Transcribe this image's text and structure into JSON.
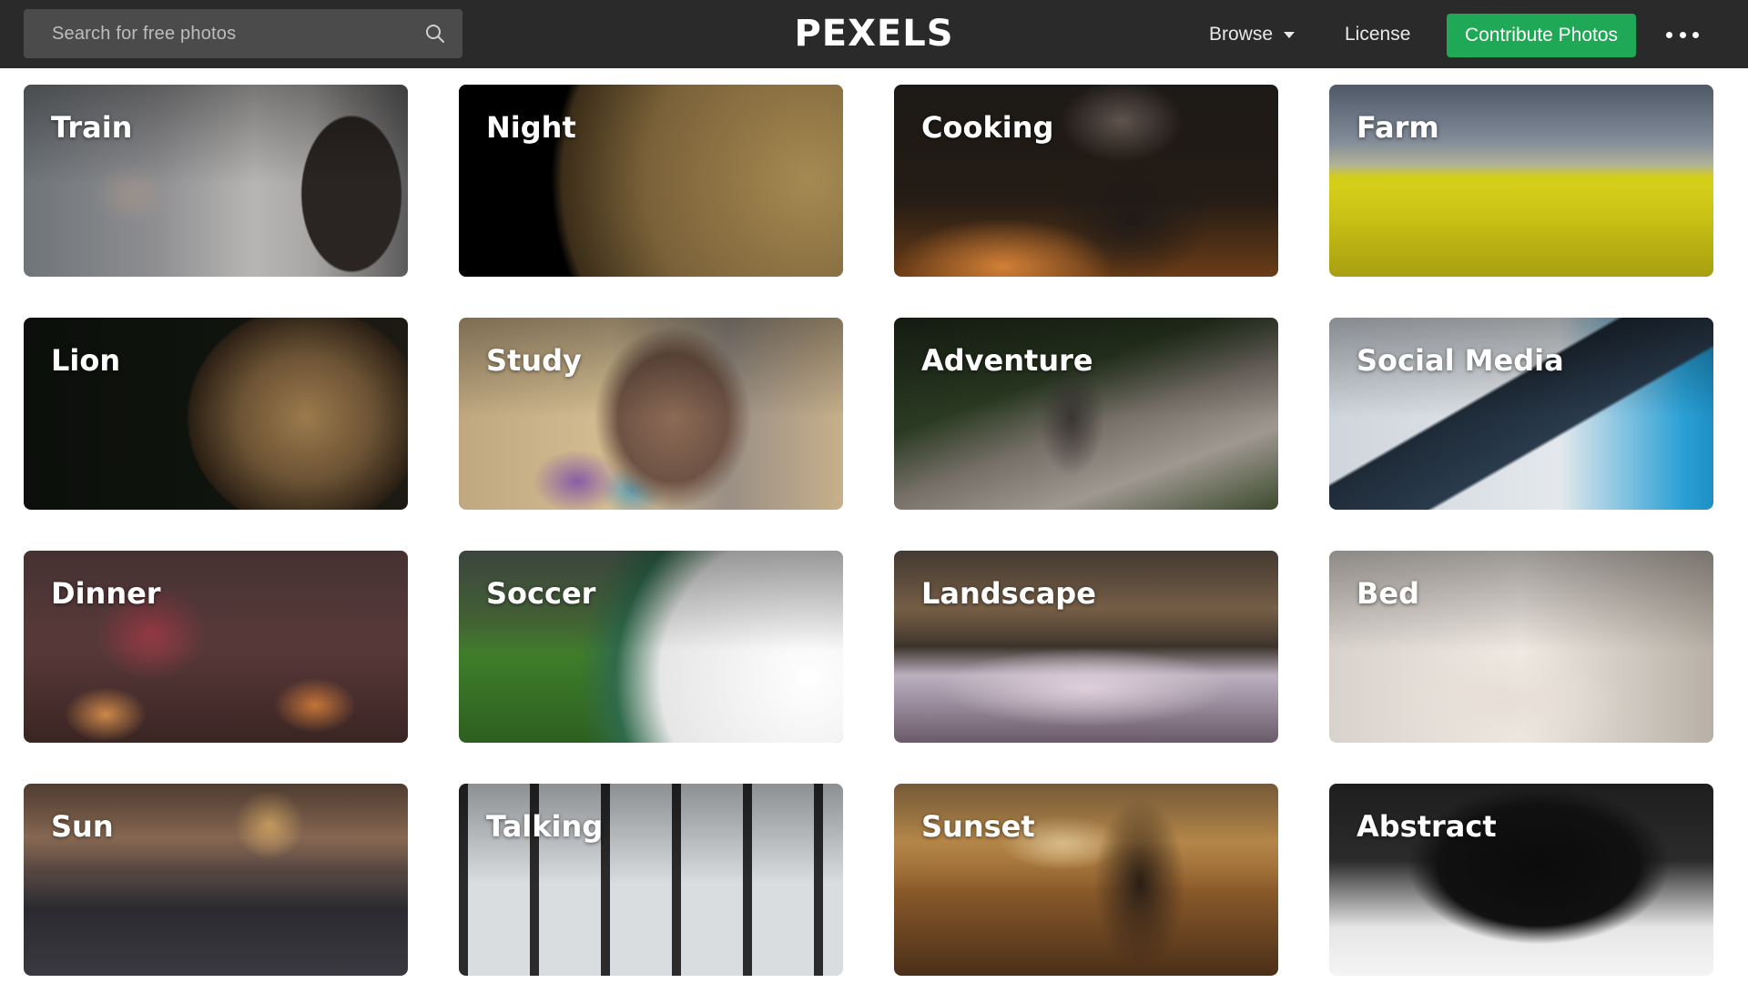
{
  "header": {
    "search_placeholder": "Search for free photos",
    "logo_text": "PEXELS",
    "nav": {
      "browse_label": "Browse",
      "license_label": "License",
      "contribute_label": "Contribute Photos",
      "more_icon": "more-dots-icon"
    },
    "colors": {
      "bar_background": "#2a2a2a",
      "search_background": "#4b4b4b",
      "contribute_button": "#1fa855"
    }
  },
  "categories": [
    {
      "label": "Train"
    },
    {
      "label": "Night"
    },
    {
      "label": "Cooking"
    },
    {
      "label": "Farm"
    },
    {
      "label": "Lion"
    },
    {
      "label": "Study"
    },
    {
      "label": "Adventure"
    },
    {
      "label": "Social Media"
    },
    {
      "label": "Dinner"
    },
    {
      "label": "Soccer"
    },
    {
      "label": "Landscape"
    },
    {
      "label": "Bed"
    },
    {
      "label": "Sun"
    },
    {
      "label": "Talking"
    },
    {
      "label": "Sunset"
    },
    {
      "label": "Abstract"
    }
  ]
}
